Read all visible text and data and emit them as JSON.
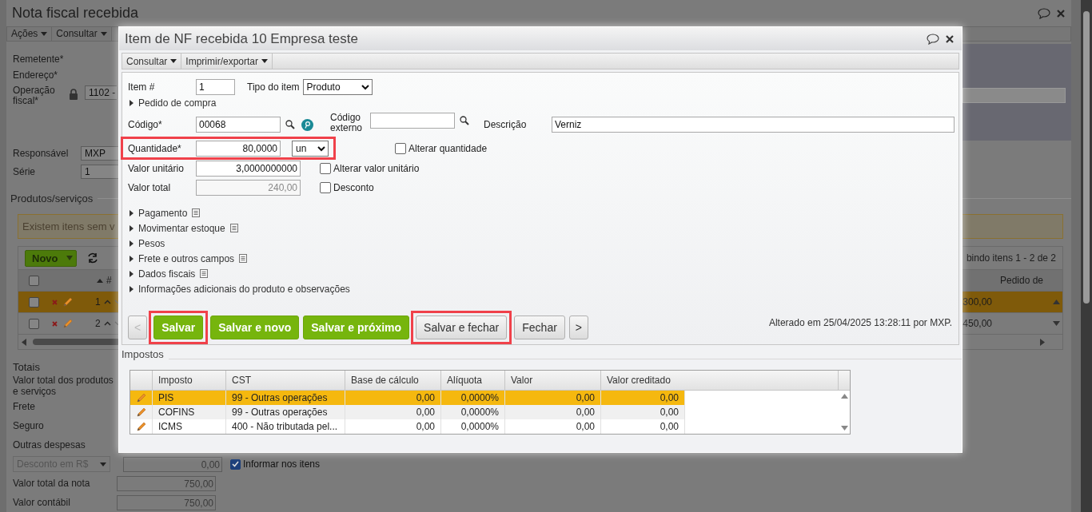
{
  "background": {
    "title": "Nota fiscal recebida",
    "menu": [
      {
        "label": "Ações"
      },
      {
        "label": "Consultar"
      }
    ],
    "fields": [
      {
        "label": "Remetente*"
      },
      {
        "label": "Endereço*"
      },
      {
        "label": "Operação fiscal*",
        "value": "1102 -"
      }
    ],
    "responsible": {
      "label": "Responsável",
      "value": "MXP"
    },
    "series": {
      "label": "Série",
      "value": "1"
    },
    "products": {
      "title": "Produtos/serviços",
      "warning": "Existem itens sem v",
      "new_button": "Novo",
      "paging": "bindo itens 1 - 2 de 2",
      "select_all": {
        "checked": false
      },
      "columns": [
        "#",
        "Pedido de"
      ],
      "rows": [
        {
          "number": "1",
          "total": "300,00",
          "selected": true,
          "checked": false
        },
        {
          "number": "2",
          "total": "450,00",
          "selected": false,
          "checked": false
        }
      ]
    },
    "totals": {
      "title": "Totais",
      "rows": [
        {
          "kind": "label",
          "label": "Valor total dos produtos e serviços"
        },
        {
          "kind": "label",
          "label": "Frete"
        },
        {
          "kind": "label",
          "label": "Seguro"
        },
        {
          "kind": "label",
          "label": "Outras despesas"
        },
        {
          "kind": "select",
          "label": "Desconto em R$",
          "amount": "0,00"
        },
        {
          "kind": "amount",
          "label": "Valor total da nota",
          "amount": "750,00"
        },
        {
          "kind": "amount",
          "label": "Valor contábil",
          "amount": "750,00"
        }
      ],
      "inform_items": {
        "label": "Informar nos itens",
        "checked": true
      }
    }
  },
  "dialog": {
    "title": "Item de NF recebida 10 Empresa teste",
    "menu": [
      {
        "label": "Consultar"
      },
      {
        "label": "Imprimir/exportar"
      }
    ],
    "item_number": {
      "label": "Item #",
      "value": "1"
    },
    "item_type": {
      "label": "Tipo do item",
      "value": "Produto"
    },
    "purchase_order": "Pedido de compra",
    "code": {
      "label": "Código*",
      "value": "00068"
    },
    "external_code": {
      "label": "Código externo"
    },
    "description": {
      "label": "Descrição",
      "value": "Verniz"
    },
    "quantity": {
      "label": "Quantidade*",
      "value": "80,0000",
      "unit": "un",
      "highlighted": true
    },
    "change_quantity": {
      "label": "Alterar quantidade",
      "checked": false
    },
    "unit_price": {
      "label": "Valor unitário",
      "value": "3,0000000000"
    },
    "change_unit_price": {
      "label": "Alterar valor unitário",
      "checked": false
    },
    "total": {
      "label": "Valor total",
      "value": "240,00",
      "disabled": true
    },
    "discount": {
      "label": "Desconto",
      "checked": false
    },
    "sections": [
      {
        "label": "Pagamento",
        "has_note": true
      },
      {
        "label": "Movimentar estoque",
        "has_note": true
      },
      {
        "label": "Pesos",
        "has_note": false
      },
      {
        "label": "Frete e outros campos",
        "has_note": true
      },
      {
        "label": "Dados fiscais",
        "has_note": true
      },
      {
        "label": "Informações adicionais do produto e observações",
        "has_note": false
      }
    ],
    "buttons": [
      {
        "label": "<",
        "kind": "nav",
        "disabled": true,
        "highlighted": false
      },
      {
        "label": "Salvar",
        "kind": "primary",
        "disabled": false,
        "highlighted": true
      },
      {
        "label": "Salvar e novo",
        "kind": "primary",
        "disabled": false,
        "highlighted": false
      },
      {
        "label": "Salvar e próximo",
        "kind": "primary",
        "disabled": false,
        "highlighted": false
      },
      {
        "label": "Salvar e fechar",
        "kind": "secondary",
        "disabled": false,
        "highlighted": true
      },
      {
        "label": "Fechar",
        "kind": "secondary",
        "disabled": false,
        "highlighted": false
      },
      {
        "label": ">",
        "kind": "nav",
        "disabled": false,
        "highlighted": false
      }
    ],
    "modified": "Alterado em 25/04/2025 13:28:11 por MXP.",
    "taxes": {
      "title": "Impostos",
      "columns": [
        "Imposto",
        "CST",
        "Base de cálculo",
        "Alíquota",
        "Valor",
        "Valor creditado"
      ],
      "rows": [
        {
          "cells": [
            "PIS",
            "99 - Outras operações",
            "0,00",
            "0,0000%",
            "0,00",
            "0,00"
          ],
          "selected": true
        },
        {
          "cells": [
            "COFINS",
            "99 - Outras operações",
            "0,00",
            "0,0000%",
            "0,00",
            "0,00"
          ],
          "selected": false
        },
        {
          "cells": [
            "ICMS",
            "400 - Não tributada pel...",
            "0,00",
            "0,0000%",
            "0,00",
            "0,00"
          ],
          "selected": false
        }
      ]
    }
  }
}
